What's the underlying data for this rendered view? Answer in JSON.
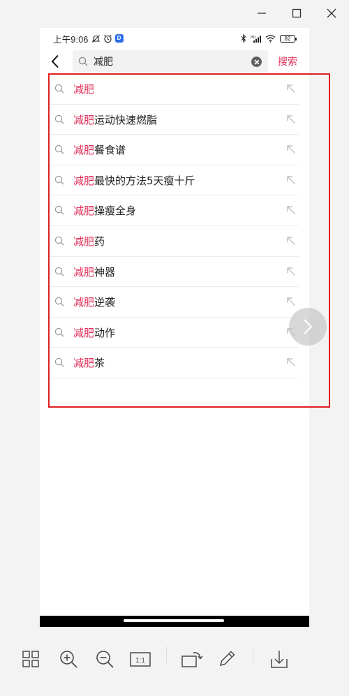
{
  "window": {
    "controls": [
      {
        "name": "minimize-icon"
      },
      {
        "name": "maximize-icon"
      },
      {
        "name": "close-icon"
      }
    ]
  },
  "status": {
    "time": "上午9:06",
    "battery": "82",
    "app_badge": "D"
  },
  "search": {
    "query": "减肥",
    "submit_label": "搜索"
  },
  "suggestions": [
    {
      "highlight": "减肥",
      "rest": ""
    },
    {
      "highlight": "减肥",
      "rest": "运动快速燃脂"
    },
    {
      "highlight": "减肥",
      "rest": "餐食谱"
    },
    {
      "highlight": "减肥",
      "rest": "最快的方法5天瘦十斤"
    },
    {
      "highlight": "减肥",
      "rest": "操瘦全身"
    },
    {
      "highlight": "减肥",
      "rest": "药"
    },
    {
      "highlight": "减肥",
      "rest": "神器"
    },
    {
      "highlight": "减肥",
      "rest": "逆袭"
    },
    {
      "highlight": "减肥",
      "rest": "动作"
    },
    {
      "highlight": "减肥",
      "rest": "茶"
    }
  ],
  "colors": {
    "accent": "#e0305a",
    "selection_border": "#e02020"
  },
  "toolbar": {
    "zoom_reset_label": "1:1"
  }
}
